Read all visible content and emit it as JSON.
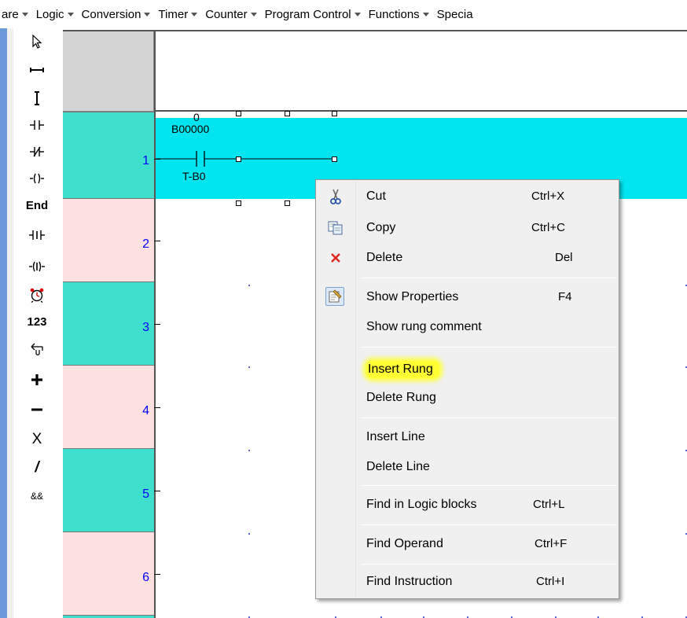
{
  "menubar": {
    "items": [
      "are",
      "Logic",
      "Conversion",
      "Timer",
      "Counter",
      "Program Control",
      "Functions",
      "Specia"
    ]
  },
  "toolbox": {
    "tools": [
      {
        "icon": "pointer-arrow-icon",
        "glyph": "⇖"
      },
      {
        "icon": "horizontal-line-icon",
        "glyph": "⟷"
      },
      {
        "icon": "vertical-line-icon",
        "glyph": "I"
      },
      {
        "icon": "no-contact-icon",
        "glyph": "⊣⊢"
      },
      {
        "icon": "nc-contact-icon",
        "glyph": "⊣/⊢"
      },
      {
        "icon": "coil-icon",
        "glyph": "-( )"
      },
      {
        "icon": "end-icon",
        "glyph": "End"
      },
      {
        "icon": "immediate-contact-icon",
        "glyph": "⊣I⊢"
      },
      {
        "icon": "immediate-coil-icon",
        "glyph": "{I}"
      },
      {
        "icon": "timer-icon",
        "glyph": "⏰"
      },
      {
        "icon": "number-icon",
        "glyph": "123"
      },
      {
        "icon": "return-icon",
        "glyph": "⮢"
      },
      {
        "icon": "plus-icon",
        "glyph": "+"
      },
      {
        "icon": "minus-icon",
        "glyph": "−"
      },
      {
        "icon": "multiply-icon",
        "glyph": "X"
      },
      {
        "icon": "divide-icon",
        "glyph": "/"
      },
      {
        "icon": "and-icon",
        "glyph": "&&"
      }
    ]
  },
  "ladder": {
    "rungs": [
      "1",
      "2",
      "3",
      "4",
      "5",
      "6"
    ],
    "rung_colors": [
      "#3fdfce",
      "#fde0e0",
      "#3fdfce",
      "#fde0e0",
      "#3fdfce",
      "#fde0e0"
    ],
    "selected_band_color": "#00e5ef",
    "contact": {
      "value": "0",
      "address": "B00000",
      "label": "T-B0"
    }
  },
  "context_menu": {
    "items": [
      {
        "label": "Cut",
        "shortcut": "Ctrl+X",
        "icon": "scissors-icon"
      },
      {
        "label": "Copy",
        "shortcut": "Ctrl+C",
        "icon": "copy-icon"
      },
      {
        "label": "Delete",
        "shortcut": "Del",
        "icon": "delete-x-icon"
      },
      {
        "label": "Show Properties",
        "shortcut": "F4",
        "icon": "properties-icon"
      },
      {
        "label": "Show rung comment",
        "shortcut": ""
      },
      {
        "label": "Insert Rung",
        "shortcut": "",
        "highlighted": true
      },
      {
        "label": "Delete Rung",
        "shortcut": ""
      },
      {
        "label": "Insert Line",
        "shortcut": ""
      },
      {
        "label": "Delete Line",
        "shortcut": ""
      },
      {
        "label": "Find in Logic blocks",
        "shortcut": "Ctrl+L"
      },
      {
        "label": "Find Operand",
        "shortcut": "Ctrl+F"
      },
      {
        "label": "Find Instruction",
        "shortcut": "Ctrl+I"
      }
    ],
    "highlight_color": "#ffff33"
  }
}
